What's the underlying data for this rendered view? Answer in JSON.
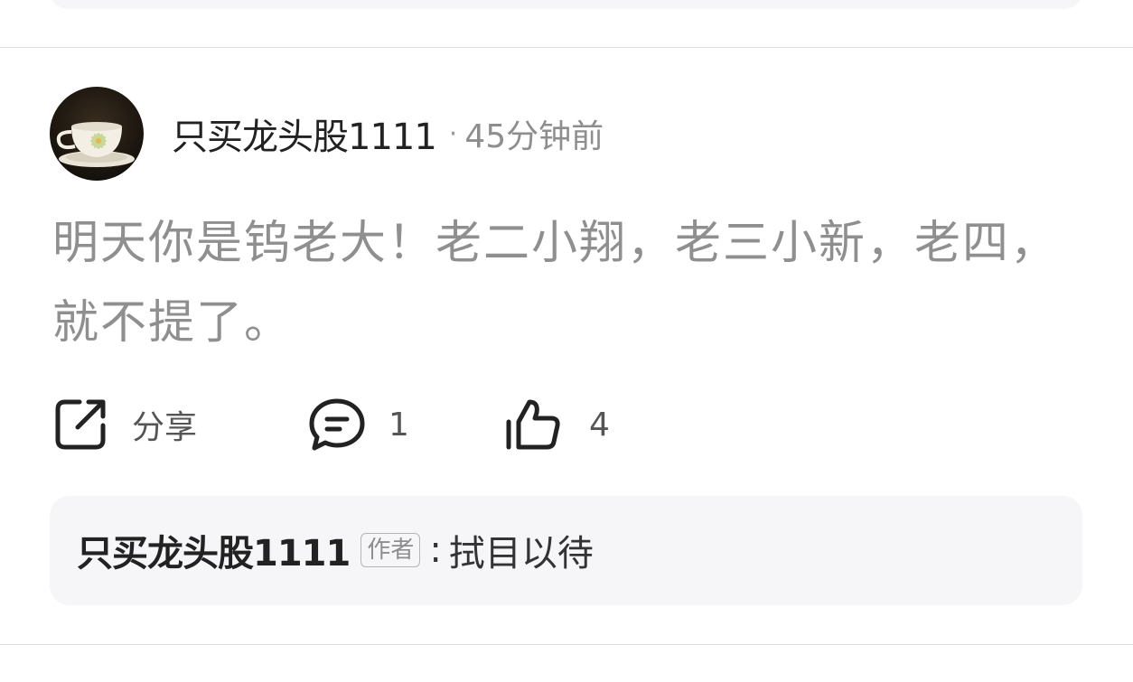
{
  "comment": {
    "author": "只买龙头股1111",
    "separator": "·",
    "time": "45分钟前",
    "content": "明天你是钨老大！老二小翔，老三小新，老四，就不提了。",
    "avatar_icon": "teacup-avatar"
  },
  "actions": {
    "share": {
      "icon": "share-icon",
      "label": "分享"
    },
    "comment": {
      "icon": "comment-icon",
      "count": "1"
    },
    "like": {
      "icon": "thumbs-up-icon",
      "count": "4"
    }
  },
  "reply": {
    "author": "只买龙头股1111",
    "badge": "作者",
    "colon": ":",
    "text": "拭目以待"
  },
  "colors": {
    "reply_bg": "#f6f6f8",
    "content_text": "#8f8f8f",
    "divider": "#dddddd"
  }
}
